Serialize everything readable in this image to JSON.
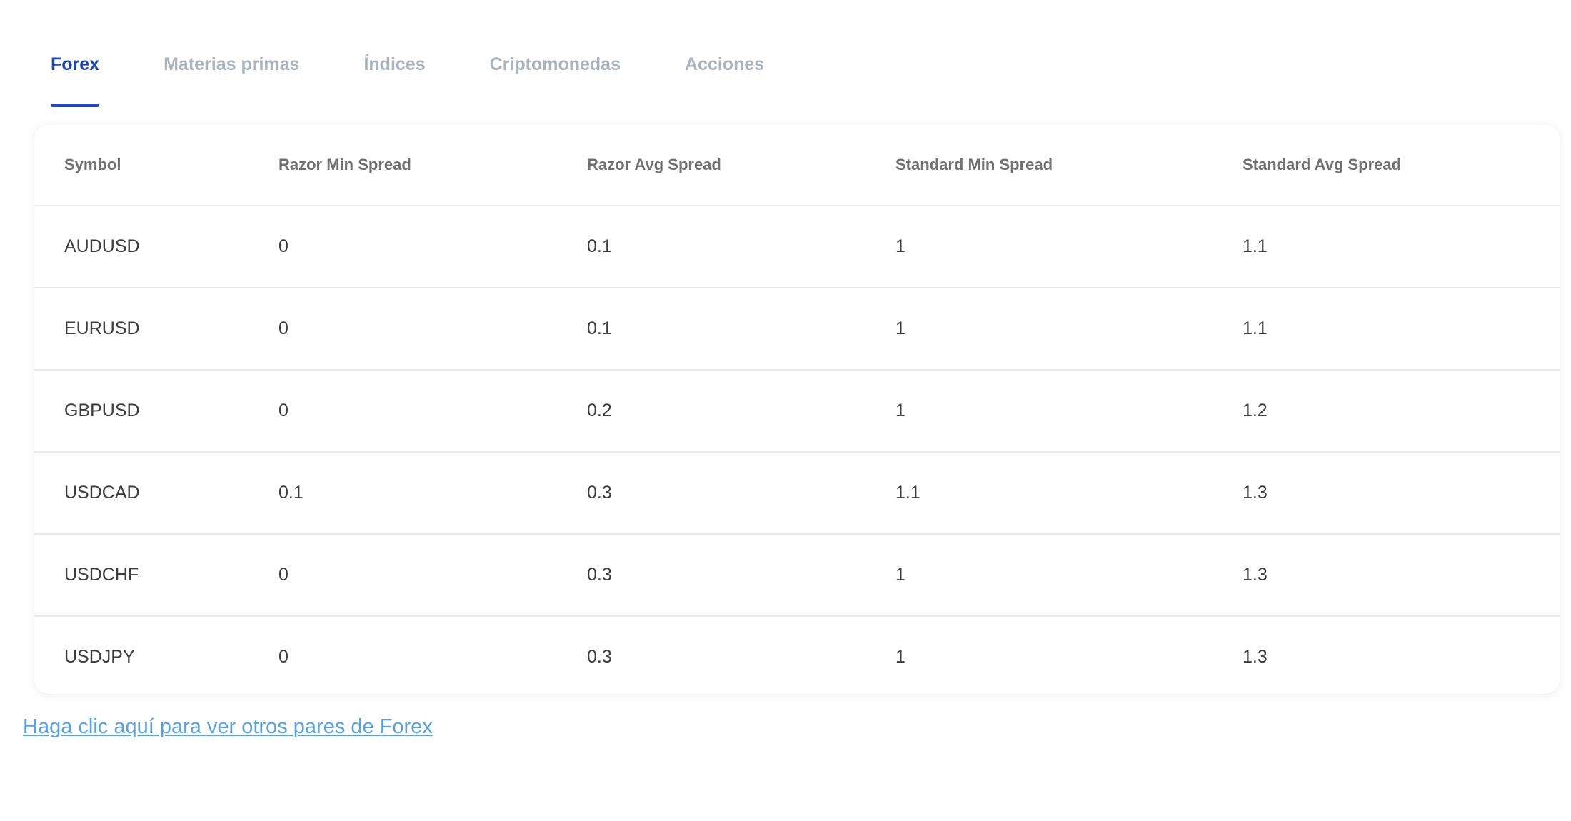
{
  "tabs": [
    {
      "label": "Forex",
      "active": true
    },
    {
      "label": "Materias primas",
      "active": false
    },
    {
      "label": "Índices",
      "active": false
    },
    {
      "label": "Criptomonedas",
      "active": false
    },
    {
      "label": "Acciones",
      "active": false
    }
  ],
  "table": {
    "headers": [
      "Symbol",
      "Razor Min Spread",
      "Razor Avg Spread",
      "Standard Min Spread",
      "Standard Avg Spread"
    ],
    "rows": [
      [
        "AUDUSD",
        "0",
        "0.1",
        "1",
        "1.1"
      ],
      [
        "EURUSD",
        "0",
        "0.1",
        "1",
        "1.1"
      ],
      [
        "GBPUSD",
        "0",
        "0.2",
        "1",
        "1.2"
      ],
      [
        "USDCAD",
        "0.1",
        "0.3",
        "1.1",
        "1.3"
      ],
      [
        "USDCHF",
        "0",
        "0.3",
        "1",
        "1.3"
      ],
      [
        "USDJPY",
        "0",
        "0.3",
        "1",
        "1.3"
      ]
    ]
  },
  "footer_link": "Haga clic aquí para ver otros pares de Forex",
  "colors": {
    "accent": "#2149c4",
    "tab_inactive": "#a8b3bd",
    "link": "#5aa1e0"
  }
}
